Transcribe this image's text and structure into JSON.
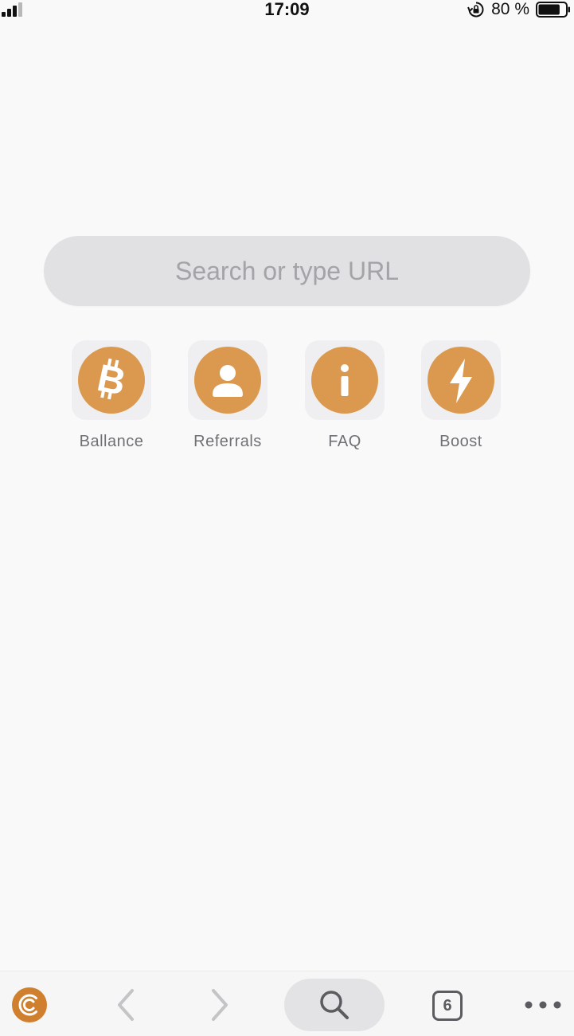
{
  "status_bar": {
    "time": "17:09",
    "battery_percent": "80 %",
    "battery_level": 0.8,
    "signal_bars": 4,
    "signal_active": 3
  },
  "search": {
    "placeholder": "Search or type URL",
    "value": ""
  },
  "shortcuts": [
    {
      "label": "Ballance",
      "icon": "bitcoin-icon"
    },
    {
      "label": "Referrals",
      "icon": "person-icon"
    },
    {
      "label": "FAQ",
      "icon": "info-icon"
    },
    {
      "label": "Boost",
      "icon": "lightning-icon"
    }
  ],
  "toolbar": {
    "tabs_count": "6",
    "items": [
      "app-logo-icon",
      "back-arrow-icon",
      "forward-arrow-icon",
      "search-icon",
      "tabs-icon",
      "more-dots-icon"
    ]
  },
  "colors": {
    "accent": "#db994f",
    "logo": "#d07f2e",
    "background": "#f9f9f9",
    "search_field": "#e1e1e3",
    "label_text": "#717175"
  }
}
